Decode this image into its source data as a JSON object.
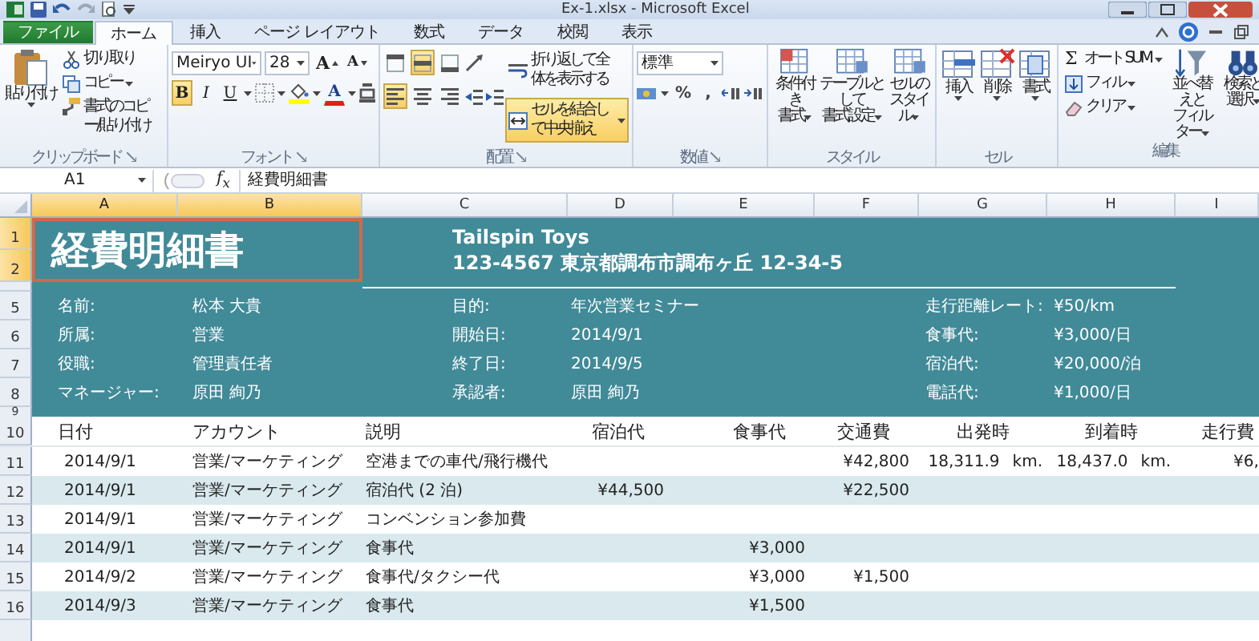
{
  "window": {
    "title": "Ex-1.xlsx - Microsoft Excel"
  },
  "ribbon_tabs": [
    {
      "label": "ファイル",
      "kind": "file",
      "selected": false
    },
    {
      "label": "ホーム",
      "kind": "tab",
      "selected": true
    },
    {
      "label": "挿入",
      "kind": "tab",
      "selected": false
    },
    {
      "label": "ページ レイアウト",
      "kind": "tab",
      "selected": false
    },
    {
      "label": "数式",
      "kind": "tab",
      "selected": false
    },
    {
      "label": "データ",
      "kind": "tab",
      "selected": false
    },
    {
      "label": "校閲",
      "kind": "tab",
      "selected": false
    },
    {
      "label": "表示",
      "kind": "tab",
      "selected": false
    }
  ],
  "clipboard": {
    "label": "クリップボード",
    "paste": "貼り付け",
    "cut": "切り取り",
    "copy": "コピー",
    "format_painter": "書式のコピー/貼り付け"
  },
  "font": {
    "label": "フォント",
    "font_name": "Meiryo UI",
    "font_size": "28",
    "grow": "A",
    "shrink": "A",
    "bold": {
      "label": "B",
      "selected": true
    },
    "italic": {
      "label": "I",
      "selected": false
    },
    "underline": {
      "label": "U",
      "selected": false
    },
    "font_color": "A"
  },
  "alignment": {
    "label": "配置",
    "vertical": [
      {
        "selected": false
      },
      {
        "selected": true
      },
      {
        "selected": false
      }
    ],
    "horizontal": [
      {
        "selected": true
      },
      {
        "selected": false
      },
      {
        "selected": false
      }
    ],
    "wrap_text": {
      "label": "折り返して全体を表示する",
      "selected": false
    },
    "merge_center": {
      "label": "セルを結合して中央揃え",
      "selected": true
    }
  },
  "number": {
    "label": "数値",
    "format": "標準",
    "percent": "%",
    "comma": ","
  },
  "styles": {
    "label": "スタイル",
    "buttons": [
      {
        "lines": [
          "条件付き",
          "書式"
        ]
      },
      {
        "lines": [
          "テーブルとして",
          "書式設定"
        ]
      },
      {
        "lines": [
          "セルの",
          "スタイル"
        ]
      }
    ]
  },
  "cells": {
    "label": "セル",
    "buttons": [
      {
        "lines": [
          "挿入"
        ]
      },
      {
        "lines": [
          "削除"
        ]
      },
      {
        "lines": [
          "書式"
        ]
      }
    ]
  },
  "editing": {
    "label": "編集",
    "autosum_symbol": "Σ",
    "autosum": "オート SUM",
    "fill": "フィル",
    "clear": "クリア",
    "buttons": [
      {
        "lines": [
          "並べ替えと",
          "フィルター"
        ]
      },
      {
        "lines": [
          "検索と",
          "選択"
        ]
      }
    ]
  },
  "formula_bar": {
    "name_box": "A1",
    "function_label": "f$_{x}$",
    "content": "経費明細書"
  },
  "columns": [
    {
      "label": "A",
      "selected": true
    },
    {
      "label": "B",
      "selected": true
    },
    {
      "label": "C",
      "selected": false
    },
    {
      "label": "D",
      "selected": false
    },
    {
      "label": "E",
      "selected": false
    },
    {
      "label": "F",
      "selected": false
    },
    {
      "label": "G",
      "selected": false
    },
    {
      "label": "H",
      "selected": false
    },
    {
      "label": "I",
      "selected": false
    }
  ],
  "sheet": {
    "title_rows": [
      {
        "label": "1",
        "selected": true
      },
      {
        "label": "2",
        "selected": true
      }
    ],
    "title": "経費明細書",
    "company": "Tailspin Toys",
    "address": "123-4567 東京都調布市調布ヶ丘 12-34-5",
    "info_rows": [
      {
        "row": "5",
        "items": [
          {
            "label": "名前:",
            "value": "松本 大貴"
          },
          {
            "label": "目的:",
            "value": "年次営業セミナー"
          },
          {
            "label": "走行距離レート:",
            "value": "¥50/km"
          }
        ]
      },
      {
        "row": "6",
        "items": [
          {
            "label": "所属:",
            "value": "営業"
          },
          {
            "label": "開始日:",
            "value": "2014/9/1"
          },
          {
            "label": "食事代:",
            "value": "¥3,000/日"
          }
        ]
      },
      {
        "row": "7",
        "items": [
          {
            "label": "役職:",
            "value": "管理責任者"
          },
          {
            "label": "終了日:",
            "value": "2014/9/5"
          },
          {
            "label": "宿泊代:",
            "value": "¥20,000/泊"
          }
        ]
      },
      {
        "row": "8",
        "items": [
          {
            "label": "マネージャー:",
            "value": "原田 絢乃"
          },
          {
            "label": "承認者:",
            "value": "原田 絢乃"
          },
          {
            "label": "電話代:",
            "value": "¥1,000/日"
          }
        ]
      }
    ],
    "spacer_row": "9",
    "header_row": "10",
    "headers": [
      "日付",
      "アカウント",
      "説明",
      "宿泊代",
      "食事代",
      "交通費",
      "出発時",
      "到着時",
      "走行費"
    ],
    "rows": [
      {
        "row": "11",
        "banded": false,
        "date": "2014/9/1",
        "account": "営業/マーケティング",
        "description": "空港までの車代/飛行機代",
        "transport": "¥42,800",
        "departure": {
          "value": "18,311.9",
          "unit": "km."
        },
        "arrival": {
          "value": "18,437.0",
          "unit": "km."
        },
        "mileage": "¥6,"
      },
      {
        "row": "12",
        "banded": true,
        "date": "2014/9/1",
        "account": "営業/マーケティング",
        "description": "宿泊代 (2 泊)",
        "lodging": "¥44,500",
        "transport": "¥22,500"
      },
      {
        "row": "13",
        "banded": false,
        "date": "2014/9/1",
        "account": "営業/マーケティング",
        "description": "コンベンション参加費"
      },
      {
        "row": "14",
        "banded": true,
        "date": "2014/9/1",
        "account": "営業/マーケティング",
        "description": "食事代",
        "meals": "¥3,000"
      },
      {
        "row": "15",
        "banded": false,
        "date": "2014/9/2",
        "account": "営業/マーケティング",
        "description": "食事代/タクシー代",
        "meals": "¥3,000",
        "transport": "¥1,500"
      },
      {
        "row": "16",
        "banded": true,
        "date": "2014/9/3",
        "account": "営業/マーケティング",
        "description": "食事代",
        "meals": "¥1,500"
      }
    ]
  }
}
